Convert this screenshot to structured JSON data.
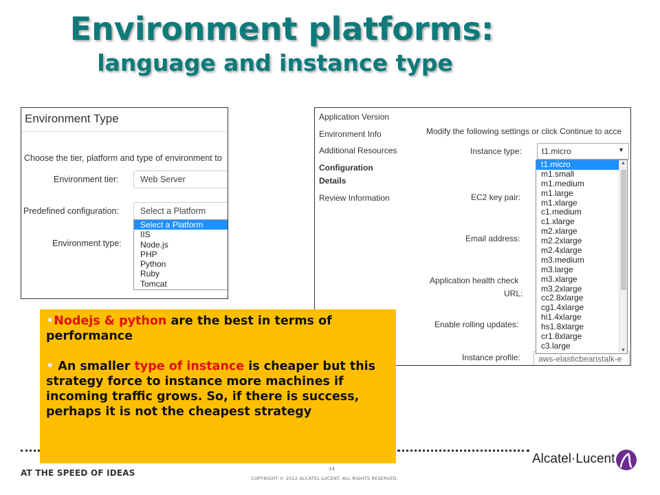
{
  "title": {
    "main": "Environment platforms:",
    "sub": "language and instance type"
  },
  "left_panel": {
    "header": "Environment Type",
    "intro": "Choose the tier, platform and type of environment to",
    "labels": {
      "tier": "Environment tier:",
      "predefined": "Predefined configuration:",
      "type": "Environment type:"
    },
    "tier_value": "Web Server",
    "predefined_value": "Select a Platform",
    "platform_options": [
      "Select a Platform",
      "IIS",
      "Node.js",
      "PHP",
      "Python",
      "Ruby",
      "Tomcat"
    ]
  },
  "right_panel": {
    "nav": [
      "Application Version",
      "Environment Info",
      "Additional Resources",
      "Configuration",
      "Details",
      "Review Information"
    ],
    "instructions": "Modify the following settings or click Continue to acce",
    "labels": {
      "instance_type": "Instance type:",
      "key_pair": "EC2 key pair:",
      "email": "Email address:",
      "health_check": "Application health check",
      "health_check_url": "URL:",
      "rolling_updates": "Enable rolling updates:",
      "instance_profile": "Instance profile:"
    },
    "instance_type_value": "t1.micro",
    "instance_options": [
      "t1.micro",
      "m1.small",
      "m1.medium",
      "m1.large",
      "m1.xlarge",
      "c1.medium",
      "c1.xlarge",
      "m2.xlarge",
      "m2.2xlarge",
      "m2.4xlarge",
      "m3.medium",
      "m3.large",
      "m3.xlarge",
      "m3.2xlarge",
      "cc2.8xlarge",
      "cg1.4xlarge",
      "hi1.4xlarge",
      "hs1.8xlarge",
      "cr1.8xlarge",
      "c3.large"
    ],
    "instance_profile_value": "aws-elasticbeanstalk-e"
  },
  "callout": {
    "bullet": "•",
    "p1": {
      "highlight": "Nodejs & python",
      "rest": " are the best in terms of performance"
    },
    "p2": {
      "before": "An smaller ",
      "highlight": "type of instance",
      "rest": " is cheaper but this strategy force to instance more machines if incoming traffic grows. So,  if there is success, perhaps it is not the cheapest strategy"
    }
  },
  "footer": {
    "tagline": "AT THE SPEED OF IDEAS",
    "page_number": "14",
    "copyright": "COPYRIGHT © 2012 ALCATEL-LUCENT.  ALL RIGHTS RESERVED.",
    "brand": "Alcatel·Lucent"
  },
  "colors": {
    "title": "#0e7a7a",
    "callout_bg": "#ffbf00",
    "highlight": "#e01010",
    "selection": "#1e90ff",
    "brand_logo": "#6b2c91"
  }
}
